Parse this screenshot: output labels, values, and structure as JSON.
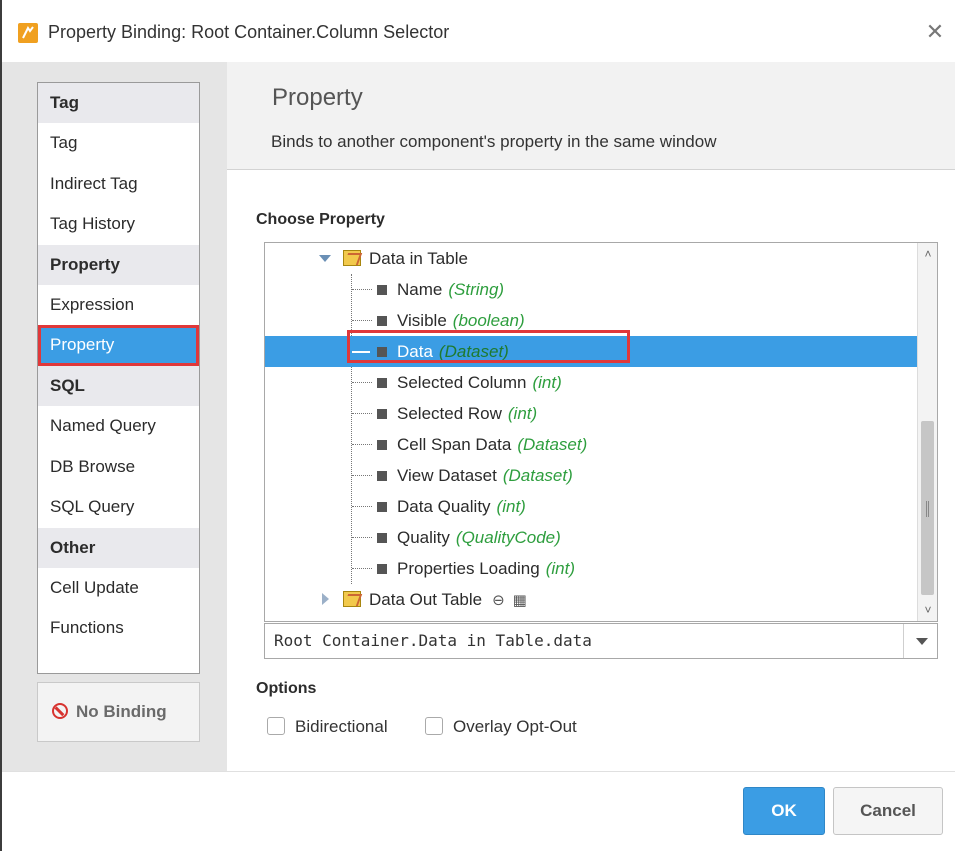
{
  "window": {
    "title": "Property Binding: Root Container.Column Selector",
    "close_glyph": "✕"
  },
  "binding_types": [
    {
      "group": "Tag",
      "items": [
        "Tag",
        "Indirect Tag",
        "Tag History"
      ]
    },
    {
      "group": "Property",
      "items": [
        "Expression",
        "Property"
      ]
    },
    {
      "group": "SQL",
      "items": [
        "Named Query",
        "DB Browse",
        "SQL Query"
      ]
    },
    {
      "group": "Other",
      "items": [
        "Cell Update",
        "Functions"
      ]
    }
  ],
  "selected_binding_type": "Property",
  "no_binding_label": "No Binding",
  "header": {
    "title": "Property",
    "description": "Binds to another component's property in the same window"
  },
  "choose_property_label": "Choose Property",
  "tree": {
    "expanded_node": "Data in Table",
    "properties": [
      {
        "name": "Name",
        "type": "(String)"
      },
      {
        "name": "Visible",
        "type": "(boolean)"
      },
      {
        "name": "Data",
        "type": "(Dataset)"
      },
      {
        "name": "Selected Column",
        "type": "(int)"
      },
      {
        "name": "Selected Row",
        "type": "(int)"
      },
      {
        "name": "Cell Span Data",
        "type": "(Dataset)"
      },
      {
        "name": "View Dataset",
        "type": "(Dataset)"
      },
      {
        "name": "Data Quality",
        "type": "(int)"
      },
      {
        "name": "Quality",
        "type": "(QualityCode)"
      },
      {
        "name": "Properties Loading",
        "type": "(int)"
      }
    ],
    "selected_property": "Data",
    "collapsed_node": "Data Out Table"
  },
  "property_path": "Root Container.Data in Table.data",
  "options": {
    "label": "Options",
    "bidirectional": "Bidirectional",
    "overlay_opt_out": "Overlay Opt-Out"
  },
  "buttons": {
    "ok": "OK",
    "cancel": "Cancel"
  },
  "colors": {
    "selection_blue": "#3b9de4",
    "highlight_red": "#e0383a",
    "type_green": "#2e9e3e"
  }
}
